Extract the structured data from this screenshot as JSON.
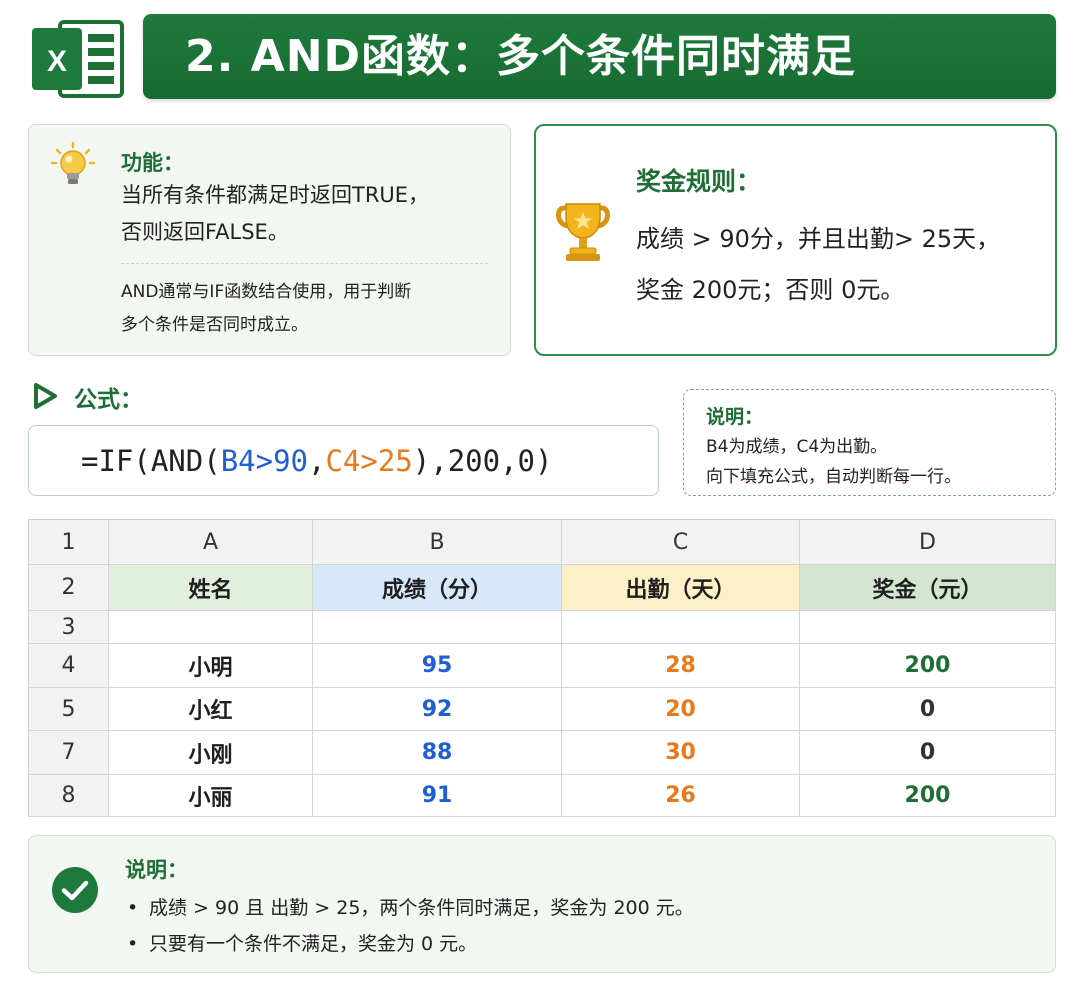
{
  "header": {
    "logo_letter": "X",
    "title": "2. AND函数：多个条件同时满足"
  },
  "function_card": {
    "label": "功能：",
    "desc_line1": "当所有条件都满足时返回TRUE，",
    "desc_line2": "否则返回FALSE。",
    "note_line1": "AND通常与IF函数结合使用，用于判断",
    "note_line2": "多个条件是否同时成立。"
  },
  "bonus_card": {
    "label": "奖金规则：",
    "line1": "成绩 > 90分，并且出勤> 25天，",
    "line2": "奖金 200元；否则 0元。"
  },
  "formula": {
    "label": "公式：",
    "part1": "=IF(AND(",
    "part2": "B4>90",
    "part3": ",",
    "part4": "C4>25",
    "part5": "),200,0)"
  },
  "note": {
    "label": "说明：",
    "line1": "B4为成绩，C4为出勤。",
    "line2": "向下填充公式，自动判断每一行。"
  },
  "sheet": {
    "corner": "1",
    "columns": [
      "A",
      "B",
      "C",
      "D"
    ],
    "header_row_num": "2",
    "headers": [
      "姓名",
      "成绩（分）",
      "出勤（天）",
      "奖金（元）"
    ],
    "blank_row_num": "3",
    "rows": [
      {
        "num": "4",
        "name": "小明",
        "score": "95",
        "attendance": "28",
        "bonus": "200"
      },
      {
        "num": "5",
        "name": "小红",
        "score": "92",
        "attendance": "20",
        "bonus": "0"
      },
      {
        "num": "7",
        "name": "小刚",
        "score": "88",
        "attendance": "30",
        "bonus": "0"
      },
      {
        "num": "8",
        "name": "小丽",
        "score": "91",
        "attendance": "26",
        "bonus": "200"
      }
    ]
  },
  "explanation": {
    "label": "说明：",
    "items": [
      "成绩 > 90 且 出勤 > 25，两个条件同时满足，奖金为 200 元。",
      "只要有一个条件不满足，奖金为 0 元。"
    ]
  },
  "colors": {
    "brand_green": "#1e6e35",
    "score_blue": "#1f5fd4",
    "attendance_orange": "#e87a1c"
  },
  "icons": [
    "excel-logo-icon",
    "lightbulb-icon",
    "trophy-icon",
    "play-icon",
    "check-circle-icon"
  ]
}
